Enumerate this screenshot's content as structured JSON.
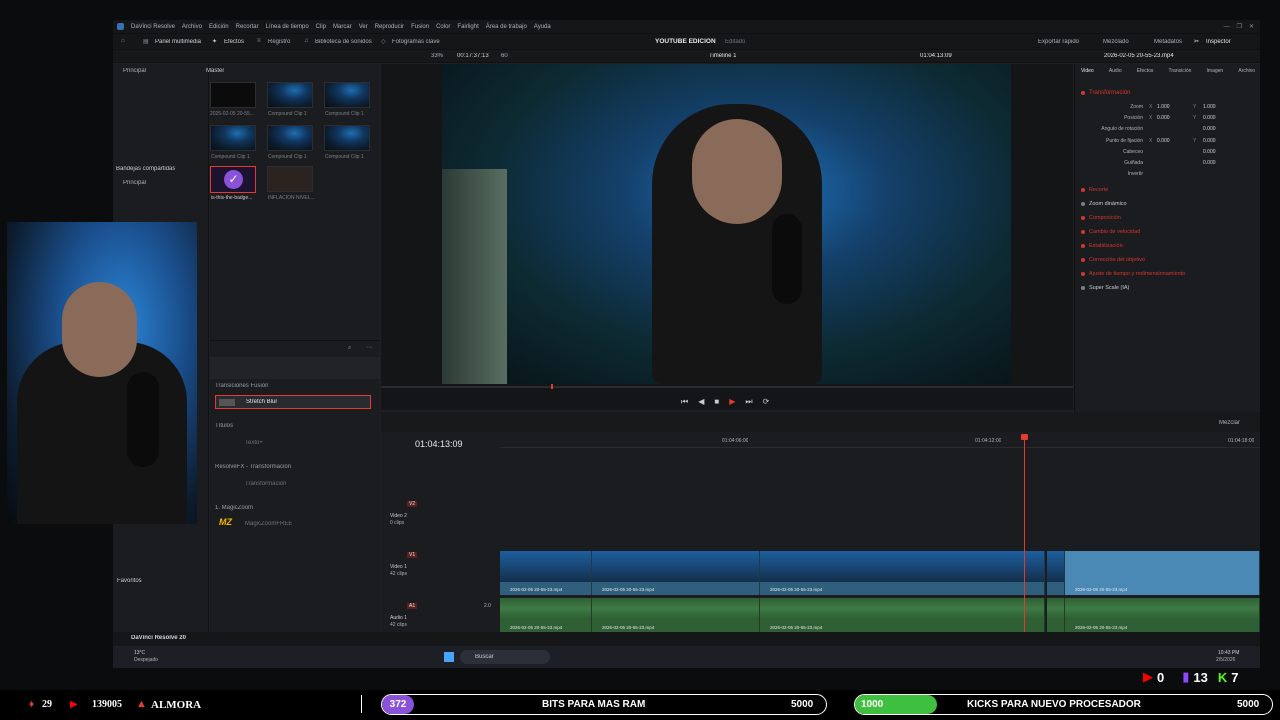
{
  "menubar": {
    "app": "DaVinci Resolve",
    "items": [
      "Archivo",
      "Edición",
      "Recortar",
      "Línea de tiempo",
      "Clip",
      "Marcar",
      "Ver",
      "Reproducir",
      "Fusion",
      "Color",
      "Fairlight",
      "Área de trabajo",
      "Ayuda"
    ]
  },
  "toolbar": {
    "media_pool": "Panel multimedia",
    "effects": "Efectos",
    "index": "Registro",
    "sound_library": "Biblioteca de sonidos",
    "keyframes": "Fotogramas clave",
    "project_title": "YOUTUBE EDICION",
    "project_status": "Editado",
    "quick_export": "Exportar rápido",
    "mixer": "Mezclado",
    "metadata": "Metadatos",
    "inspector": "Inspector"
  },
  "viewer": {
    "zoom": "33%",
    "timecode_left": "00:17:37:13",
    "fps": "60",
    "timeline_name": "Timeline 1",
    "timecode_right": "01:04:13:09",
    "clip_name": "2026-02-05 20-55-23.mp4"
  },
  "sidebar": {
    "root": "Principal",
    "shared": "Bandejas compartidas",
    "shared_root": "Principal",
    "favorites": "Favoritos"
  },
  "media_pool": {
    "bin": "Master",
    "items": [
      {
        "label": "2026-02-05 20-55..."
      },
      {
        "label": "Compound Clip 1"
      },
      {
        "label": "Compound Clip 1"
      },
      {
        "label": "Compound Clip 1"
      },
      {
        "label": "Compound Clip 1"
      },
      {
        "label": "Compound Clip 1"
      },
      {
        "label": "is-this-the-badge..."
      },
      {
        "label": "INFLACION NIVEL..."
      }
    ]
  },
  "effects": {
    "sections": [
      {
        "title": "Transiciones Fusion",
        "item": "Stretch Blur"
      },
      {
        "title": "Títulos",
        "item": "Texto+"
      },
      {
        "title": "ResolveFX - Transformación",
        "item": "Transformación"
      },
      {
        "title": "1. MagicZoom",
        "item": "MagicZoomFREE"
      }
    ],
    "mz_logo": "MZ"
  },
  "inspector": {
    "tabs": [
      "Video",
      "Audio",
      "Efectos",
      "Transición",
      "Imagen",
      "Archivo"
    ],
    "section": "Transformación",
    "rows": [
      {
        "label": "Zoom",
        "x_label": "X",
        "x": "1.000",
        "y_label": "Y",
        "y": "1.000"
      },
      {
        "label": "Posición",
        "x_label": "X",
        "x": "0.000",
        "y_label": "Y",
        "y": "0.000"
      },
      {
        "label": "Ángulo de rotación",
        "x_label": "",
        "x": "",
        "y_label": "",
        "y": "0.000"
      },
      {
        "label": "Punto de fijación",
        "x_label": "X",
        "x": "0.000",
        "y_label": "Y",
        "y": "0.000"
      },
      {
        "label": "Cabeceo",
        "x_label": "",
        "x": "",
        "y_label": "",
        "y": "0.000"
      },
      {
        "label": "Guiñada",
        "x_label": "",
        "x": "",
        "y_label": "",
        "y": "0.000"
      },
      {
        "label": "Invertir",
        "x_label": "",
        "x": "",
        "y_label": "",
        "y": ""
      }
    ],
    "sections": [
      "Recorte",
      "Zoom dinámico",
      "Composición",
      "Cambio de velocidad",
      "Estabilización",
      "Corrección del objetivo",
      "Ajuste de tiempo y redimensionamiento",
      "Super Scale (IA)"
    ]
  },
  "timeline": {
    "timecode": "01:04:13:09",
    "ruler": [
      "01:04:06:00",
      "01:04:12:00",
      "01:04:18:00"
    ],
    "v2": {
      "tag": "V2",
      "name": "Video 2",
      "sub": "0 clips"
    },
    "v1": {
      "tag": "V1",
      "name": "Video 1",
      "sub": "42 clips"
    },
    "a1": {
      "tag": "A1",
      "name": "Audio 1",
      "sub": "42 clips",
      "ch": "2.0"
    },
    "clip_name": "2026-02-05 20-55-23.mp4",
    "mix_label": "Mezclar"
  },
  "footer": {
    "app": "DaVinci Resolve 20"
  },
  "taskbar": {
    "weather_temp": "13°C",
    "weather_desc": "Despejado",
    "search": "Buscar",
    "time": "10:43 PM",
    "date": "2/5/2026"
  },
  "stream_overlay": {
    "yt_count": "0",
    "twitch_count": "13",
    "kick_count": "7",
    "left_count": "29",
    "yt_subs": "139005",
    "handle": "ALMORA",
    "goal1_badge": "372",
    "goal1_text": "BITS PARA MAS RAM",
    "goal1_target": "5000",
    "goal2_badge": "1000",
    "goal2_text": "KICKS PARA NUEVO PROCESADOR",
    "goal2_target": "5000"
  },
  "colors": {
    "accent_red": "#d5362f",
    "playhead": "#e53b2f",
    "goal_purple": "#8a52d8",
    "goal_green": "#3fbf3f",
    "kick_green": "#53fc18",
    "twitch_purple": "#9146ff",
    "yt_red": "#ff0000"
  }
}
